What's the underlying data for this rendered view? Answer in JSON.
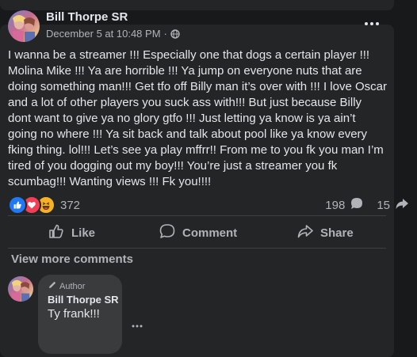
{
  "post": {
    "author": "Bill Thorpe SR",
    "timestamp": "December 5 at 10:48 PM",
    "separator": "·",
    "privacy_icon": "globe-icon",
    "text": "I wanna be a streamer !!! Especially one that dogs a certain player !!! Molina Mike !!! Ya are horrible !!! Ya jump on everyone nuts that are doing something man!!! Get tfo off Billy man it’s over with !!! I love Oscar and a lot of other players you suck ass with!!! But just because Billy dont want to give ya no glory gtfo !!! Just letting ya know is ya ain’t going no where !!! Ya sit back and talk about pool like ya know every fking thing. lol!!! Let’s see ya play mffrr!! From me to you fk you man I’m tired of you dogging out my boy!!! You’re just a streamer you fk scumbag!!! Wanting views !!! Fk you!!!!",
    "reactions": [
      "like",
      "love",
      "haha"
    ],
    "reaction_count": "372",
    "comment_count": "198",
    "share_count": "15"
  },
  "actions": {
    "like_label": "Like",
    "comment_label": "Comment",
    "share_label": "Share"
  },
  "comments": {
    "view_more": "View more comments",
    "first": {
      "badge": "Author",
      "author": "Bill Thorpe SR",
      "text": "Ty frank!!!"
    }
  },
  "colors": {
    "background": "#18191a",
    "card": "#242526",
    "bubble": "#3a3b3c",
    "text_primary": "#e4e6eb",
    "text_secondary": "#b0b3b8",
    "like_blue": "#2078f4",
    "love_red": "#f33e58",
    "haha_yellow": "#f7b125"
  }
}
